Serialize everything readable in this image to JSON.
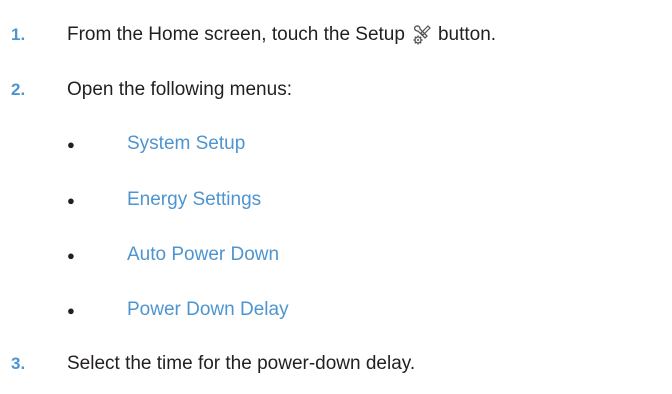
{
  "steps": [
    {
      "number": "1.",
      "text_before": "From the Home screen, touch the Setup",
      "icon": "setup-wrench-icon",
      "text_after": "button."
    },
    {
      "number": "2.",
      "text": "Open the following menus:"
    },
    {
      "number": "3.",
      "text": "Select the time for the power-down delay."
    }
  ],
  "menus": [
    {
      "bullet": "●",
      "label": "System Setup"
    },
    {
      "bullet": "●",
      "label": "Energy Settings"
    },
    {
      "bullet": "●",
      "label": "Auto Power Down"
    },
    {
      "bullet": "●",
      "label": "Power Down Delay"
    }
  ],
  "colors": {
    "accent": "#4e95d0",
    "text": "#231f20",
    "background": "#ffffff"
  }
}
